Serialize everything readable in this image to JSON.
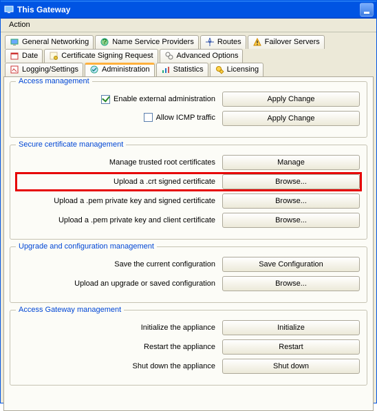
{
  "window": {
    "title": "This Gateway"
  },
  "menu": {
    "action": "Action"
  },
  "tabs": {
    "row1": [
      {
        "name": "general-networking",
        "label": "General Networking"
      },
      {
        "name": "name-service",
        "label": "Name Service Providers"
      },
      {
        "name": "routes",
        "label": "Routes"
      },
      {
        "name": "failover",
        "label": "Failover Servers"
      }
    ],
    "row2": [
      {
        "name": "date",
        "label": "Date"
      },
      {
        "name": "csr",
        "label": "Certificate Signing Request"
      },
      {
        "name": "advanced",
        "label": "Advanced Options"
      }
    ],
    "row3": [
      {
        "name": "logging",
        "label": "Logging/Settings"
      },
      {
        "name": "administration",
        "label": "Administration"
      },
      {
        "name": "statistics",
        "label": "Statistics"
      },
      {
        "name": "licensing",
        "label": "Licensing"
      }
    ]
  },
  "groups": {
    "access": {
      "legend": "Access management",
      "enable_ext_admin_label": "Enable external administration",
      "enable_ext_admin_checked": true,
      "allow_icmp_label": "Allow ICMP traffic",
      "allow_icmp_checked": false,
      "apply_change": "Apply Change"
    },
    "secure": {
      "legend": "Secure certificate management",
      "rows": [
        {
          "label": "Manage trusted root certificates",
          "btn": "Manage",
          "name": "manage-root-certs"
        },
        {
          "label": "Upload a .crt signed certificate",
          "btn": "Browse...",
          "name": "upload-crt",
          "highlight": true
        },
        {
          "label": "Upload a .pem private key and signed certificate",
          "btn": "Browse...",
          "name": "upload-pem-signed"
        },
        {
          "label": "Upload a .pem private key and client certificate",
          "btn": "Browse...",
          "name": "upload-pem-client"
        }
      ]
    },
    "upgrade": {
      "legend": "Upgrade and configuration management",
      "rows": [
        {
          "label": "Save the current configuration",
          "btn": "Save Configuration",
          "name": "save-config"
        },
        {
          "label": "Upload an upgrade or saved configuration",
          "btn": "Browse...",
          "name": "upload-config"
        }
      ]
    },
    "gateway": {
      "legend": "Access Gateway management",
      "rows": [
        {
          "label": "Initialize the appliance",
          "btn": "Initialize",
          "name": "initialize"
        },
        {
          "label": "Restart the appliance",
          "btn": "Restart",
          "name": "restart"
        },
        {
          "label": "Shut down the appliance",
          "btn": "Shut down",
          "name": "shutdown"
        }
      ]
    }
  }
}
